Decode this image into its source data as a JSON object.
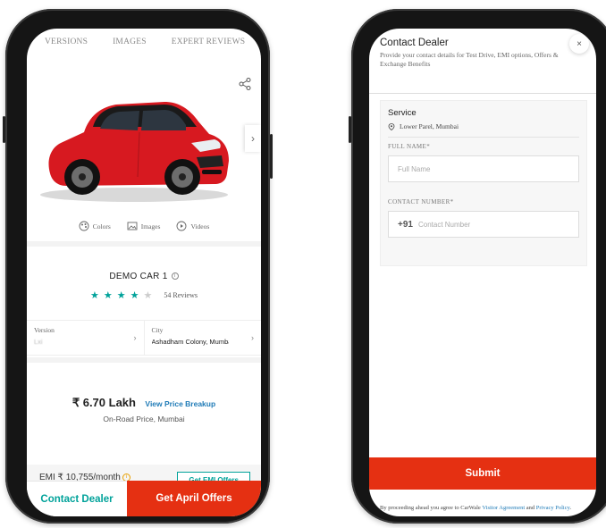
{
  "left_screen": {
    "tabs": [
      "VERSIONS",
      "IMAGES",
      "EXPERT REVIEWS"
    ],
    "media": [
      {
        "label": "Colors",
        "icon": "palette-icon"
      },
      {
        "label": "Images",
        "icon": "image-icon"
      },
      {
        "label": "Videos",
        "icon": "play-icon"
      }
    ],
    "model_name": "DEMO CAR 1",
    "rating": 4,
    "reviews": "54 Reviews",
    "version_label": "Version",
    "version_value": "Lxi",
    "city_label": "City",
    "city_value": "Ashadham Colony, Mumbai",
    "price": "₹ 6.70 Lakh",
    "price_link": "View Price Breakup",
    "price_subtitle": "On-Road Price, Mumbai",
    "emi_text": "EMI ₹ 10,755/month",
    "emi_button": "Get EMI Offers",
    "contact_button": "Contact Dealer",
    "offers_button": "Get April Offers",
    "car_color": "#d71920"
  },
  "right_screen": {
    "title": "Contact Dealer",
    "subtitle": "Provide your contact details for Test Drive, EMI options, Offers & Exchange Benefits",
    "close": "×",
    "service_title": "Service",
    "location": "Lower Parel, Mumbai",
    "full_name_label": "FULL NAME*",
    "full_name_placeholder": "Full Name",
    "contact_label": "CONTACT NUMBER*",
    "phone_prefix": "+91",
    "contact_placeholder": "Contact Number",
    "submit": "Submit",
    "legal_prefix": "By proceeding ahead you agree to CarWale ",
    "legal_link1": "Visitor Agreement",
    "legal_mid": " and ",
    "legal_link2": "Privacy Policy",
    "legal_end": "."
  },
  "colors": {
    "accent_teal": "#00a29a",
    "accent_red": "#e53012",
    "link_blue": "#1f7bb7"
  }
}
